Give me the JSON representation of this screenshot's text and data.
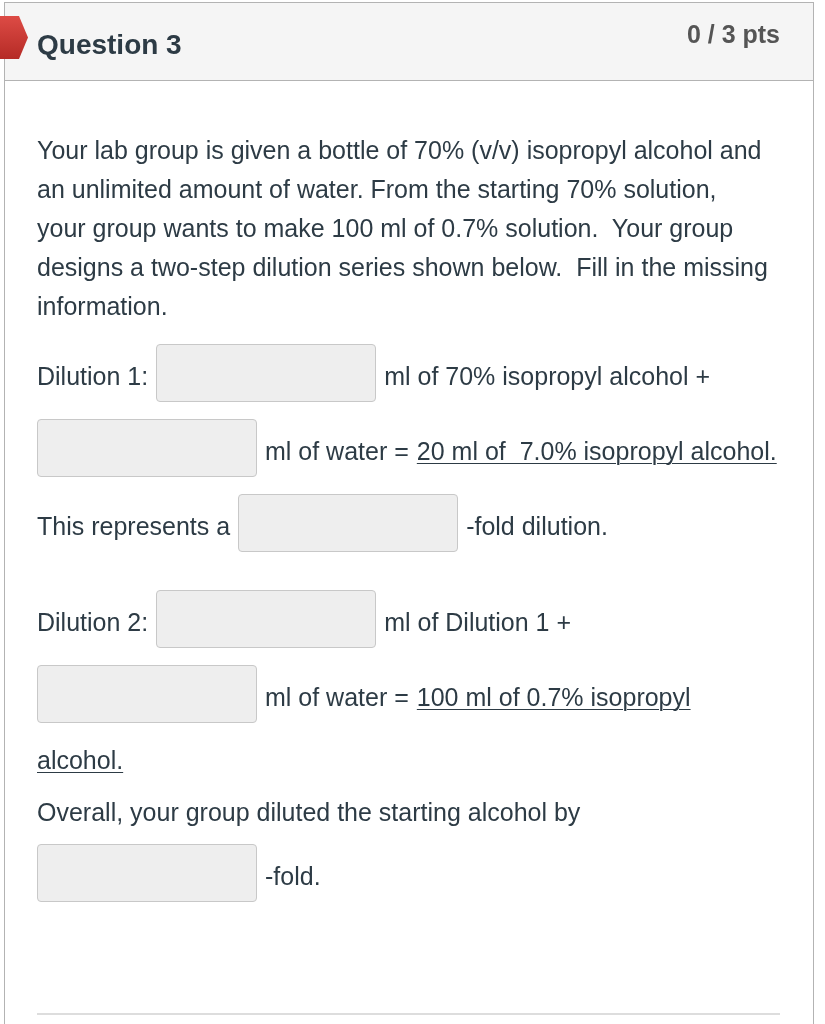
{
  "question": {
    "title": "Question 3",
    "points": "0 / 3 pts",
    "incorrect": true
  },
  "prompt": "Your lab group is given a bottle of 70% (v/v) isopropyl alcohol and an unlimited amount of water. From the starting 70% solution, your group wants to make 100 ml of 0.7% solution.  Your group designs a two-step dilution series shown below.  Fill in the missing information.",
  "answer_blocks": [
    {
      "lines": [
        {
          "segments": [
            {
              "kind": "text",
              "text": "Dilution 1:"
            },
            {
              "kind": "blank"
            },
            {
              "kind": "text",
              "text": "ml of 70% isopropyl alcohol +"
            }
          ]
        },
        {
          "segments": [
            {
              "kind": "blank"
            },
            {
              "kind": "text",
              "text": "ml of water ="
            },
            {
              "kind": "underlined",
              "text": "20 ml of  7.0% isopropyl alcohol."
            }
          ]
        },
        {
          "segments": [
            {
              "kind": "text",
              "text": "This represents a"
            },
            {
              "kind": "blank"
            },
            {
              "kind": "text",
              "text": "-fold dilution."
            }
          ]
        }
      ]
    },
    {
      "lines": [
        {
          "segments": [
            {
              "kind": "text",
              "text": "Dilution 2:"
            },
            {
              "kind": "blank"
            },
            {
              "kind": "text",
              "text": "ml of Dilution 1 +"
            }
          ]
        },
        {
          "segments": [
            {
              "kind": "blank"
            },
            {
              "kind": "text",
              "text": "ml of water ="
            },
            {
              "kind": "underlined",
              "text": "100 ml of 0.7% isopropyl"
            }
          ]
        },
        {
          "segments": [
            {
              "kind": "underlined",
              "text": "alcohol."
            }
          ]
        },
        {
          "segments": [
            {
              "kind": "text",
              "text": "Overall, your group diluted the starting alcohol by"
            }
          ]
        },
        {
          "segments": [
            {
              "kind": "blank"
            },
            {
              "kind": "text",
              "text": "-fold."
            }
          ]
        }
      ]
    }
  ]
}
